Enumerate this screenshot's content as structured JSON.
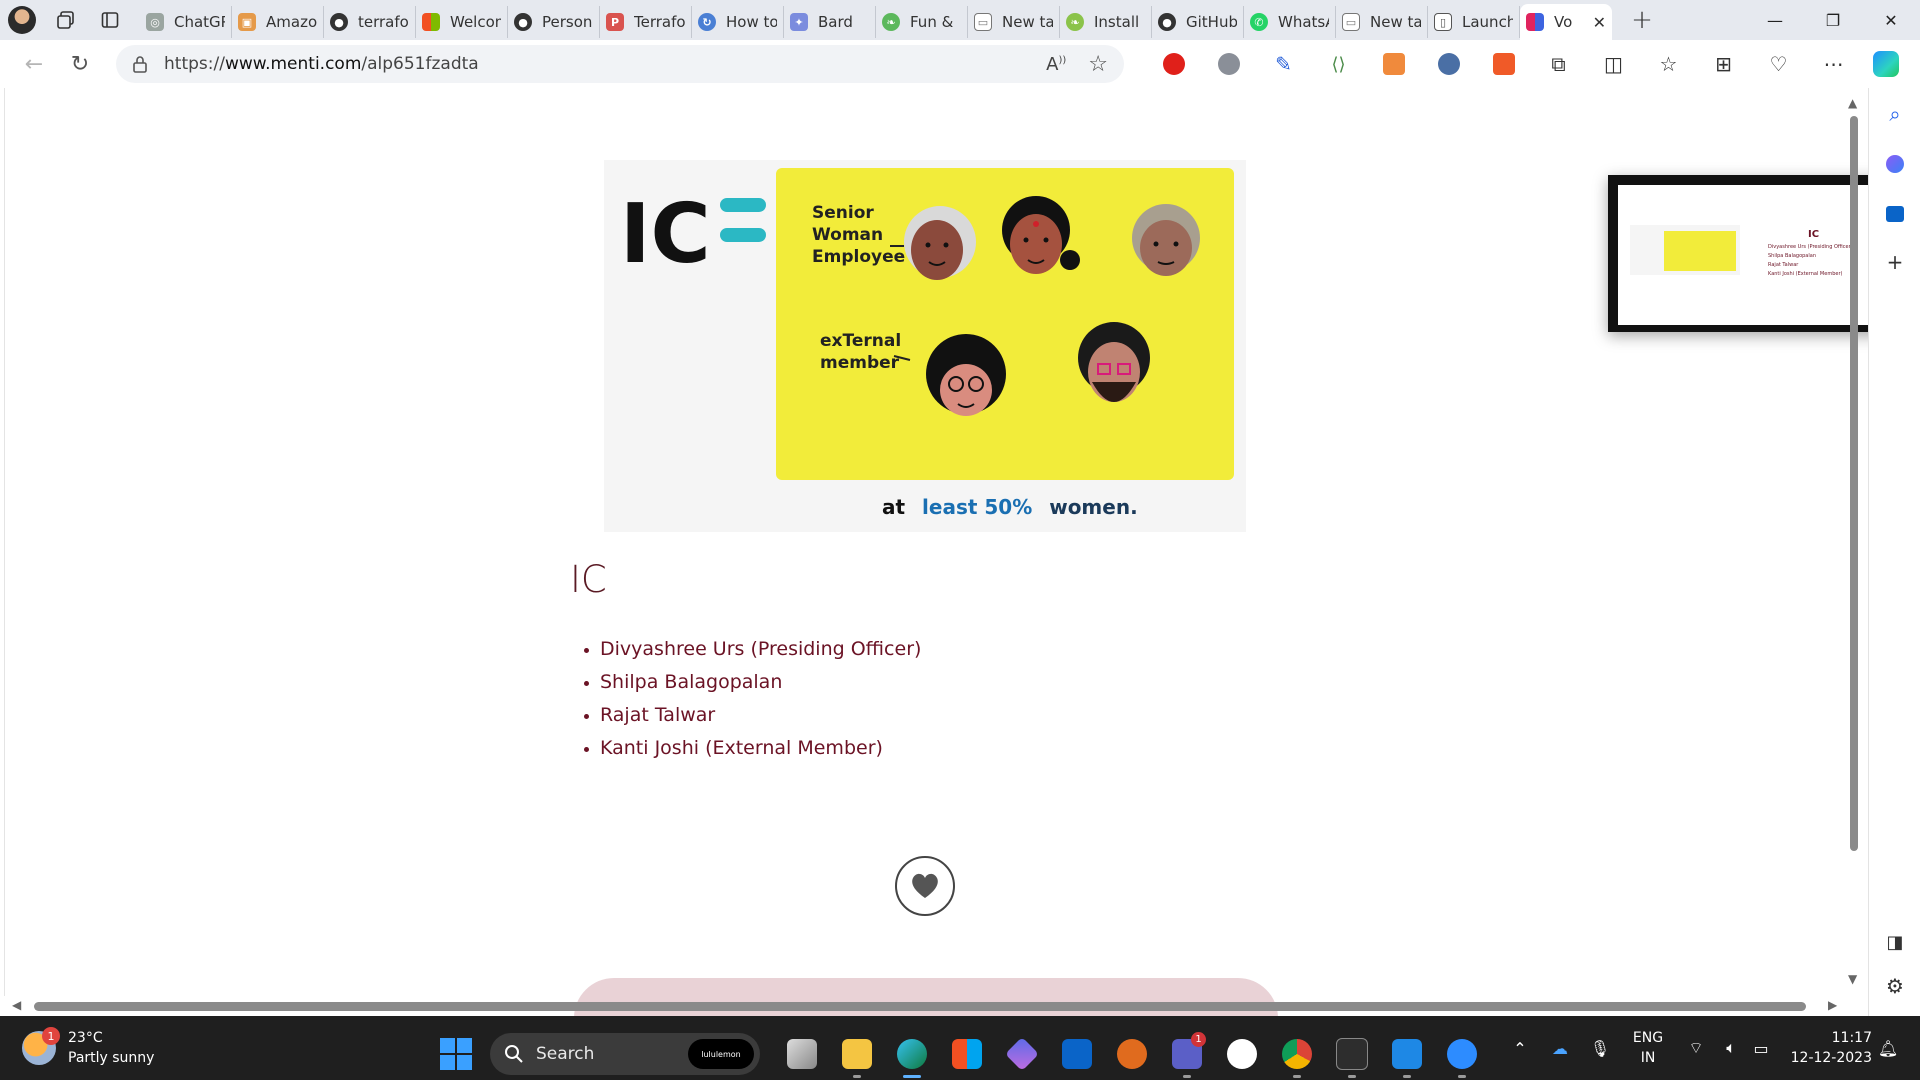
{
  "browser": {
    "tabs": [
      {
        "label": "ChatGPT",
        "icon": "openai-icon",
        "color": "#9aa5a0"
      },
      {
        "label": "Amazon",
        "icon": "box-icon",
        "color": "#e59a4a"
      },
      {
        "label": "terraform",
        "icon": "github-icon",
        "color": "#333333"
      },
      {
        "label": "Welcome",
        "icon": "microsoft-icon",
        "color": "#7fba00"
      },
      {
        "label": "Personal",
        "icon": "github-icon",
        "color": "#333333"
      },
      {
        "label": "Terraform",
        "icon": "pdf-icon",
        "color": "#d9534f"
      },
      {
        "label": "How to",
        "icon": "sync-icon",
        "color": "#4a7fd4"
      },
      {
        "label": "Bard",
        "icon": "sparkle-icon",
        "color": "#7b8cde"
      },
      {
        "label": "Fun &",
        "icon": "leaf-icon",
        "color": "#5cb85c"
      },
      {
        "label": "New tab",
        "icon": "page-icon",
        "color": "#777777"
      },
      {
        "label": "Install",
        "icon": "leaf-icon",
        "color": "#8bc34a"
      },
      {
        "label": "GitHub",
        "icon": "github-icon",
        "color": "#333333"
      },
      {
        "label": "WhatsApp",
        "icon": "whatsapp-icon",
        "color": "#25d366"
      },
      {
        "label": "New tab",
        "icon": "page-icon",
        "color": "#777777"
      },
      {
        "label": "Launch",
        "icon": "document-icon",
        "color": "#555555"
      },
      {
        "label": "Vo",
        "icon": "menti-icon",
        "color": "#e0245e",
        "active": true
      }
    ],
    "url_prefix": "https://",
    "url_host": "www.menti.com",
    "url_path": "/alp651fzadta"
  },
  "slide": {
    "title": "IC",
    "members": [
      "Divyashree Urs (Presiding Officer)",
      "Shilpa Balagopalan",
      "Rajat Talwar",
      "Kanti Joshi (External Member)"
    ],
    "illustration": {
      "heading": "IC",
      "label_senior": [
        "Senior",
        "Woman",
        "Employee"
      ],
      "label_external": [
        "exTernal",
        "member"
      ],
      "footer_prefix": "at",
      "footer_highlight": "least 50%",
      "footer_suffix": "women."
    }
  },
  "preview": {
    "title": "IC",
    "members": [
      "Divyashree Urs (Presiding Officer)",
      "Shilpa Balagopalan",
      "Rajat Talwar",
      "Kanti Joshi (External Member)"
    ]
  },
  "taskbar": {
    "temperature": "23°C",
    "weather": "Partly sunny",
    "weather_badge": "1",
    "search_label": "Search",
    "search_promo": "lululemon",
    "lang_line1": "ENG",
    "lang_line2": "IN",
    "time": "11:17",
    "date": "12-12-2023",
    "teams_badge": "1"
  },
  "colors": {
    "accent_text": "#6b1325",
    "illustration_yellow": "#f2ec3a",
    "teal": "#2bb8c4"
  }
}
